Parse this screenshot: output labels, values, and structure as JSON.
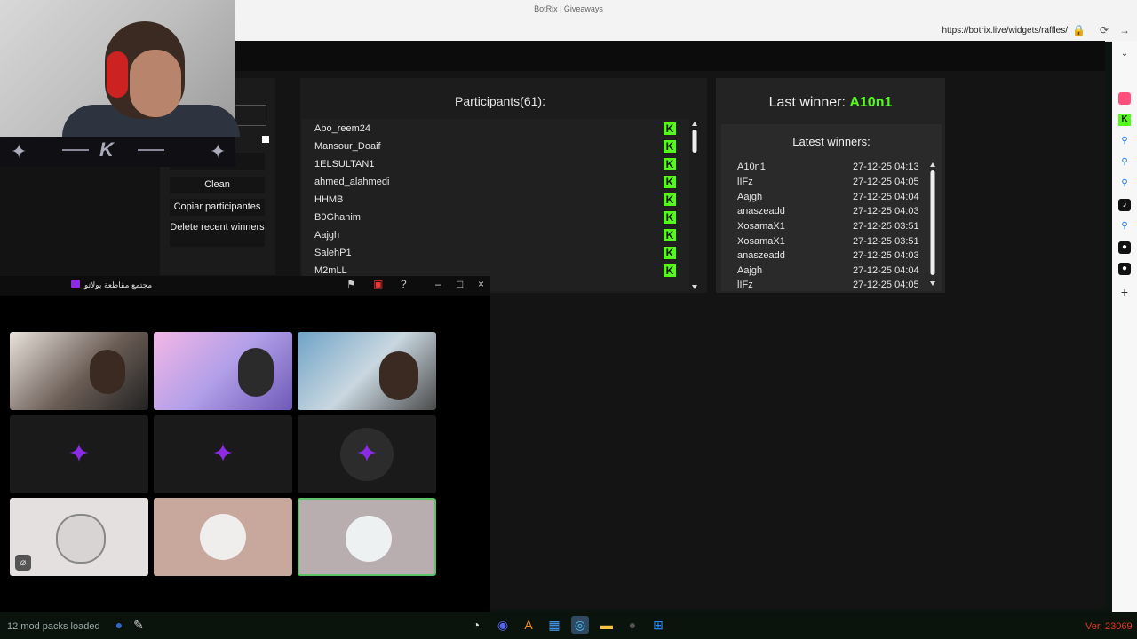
{
  "browser": {
    "window_title": "BotRix | Giveaways",
    "url": "https://botrix.live/widgets/raffles/"
  },
  "controls": {
    "clean": "Clean",
    "copy": "Copiar participantes",
    "delete": "Delete recent winners"
  },
  "participants": {
    "title": "Participants(61):",
    "rows": [
      "Abo_reem24",
      "Mansour_Doaif",
      "1ELSULTAN1",
      "ahmed_alahmedi",
      "HHMB",
      "B0Ghanim",
      "Aajgh",
      "SalehP1",
      "M2mLL"
    ]
  },
  "winners": {
    "last_label": "Last winner:",
    "last_name": "A10n1",
    "latest_title": "Latest winners:",
    "rows": [
      {
        "name": "A10n1",
        "date": "27-12-25 04:13"
      },
      {
        "name": "lIFz",
        "date": "27-12-25 04:05"
      },
      {
        "name": "Aajgh",
        "date": "27-12-25 04:04"
      },
      {
        "name": "anaszeadd",
        "date": "27-12-25 04:03"
      },
      {
        "name": "XosamaX1",
        "date": "27-12-25 03:51"
      },
      {
        "name": "XosamaX1",
        "date": "27-12-25 03:51"
      },
      {
        "name": "anaszeadd",
        "date": "27-12-25 04:03"
      },
      {
        "name": "Aajgh",
        "date": "27-12-25 04:04"
      },
      {
        "name": "lIFz",
        "date": "27-12-25 04:05"
      }
    ]
  },
  "call": {
    "title": "مجتمع مقاطعة بولاتو"
  },
  "taskbar": {
    "mods": "12 mod packs loaded",
    "version": "Ver. 23069"
  },
  "colors": {
    "kick_green": "#53fc18",
    "version_red": "#e03b1e"
  }
}
